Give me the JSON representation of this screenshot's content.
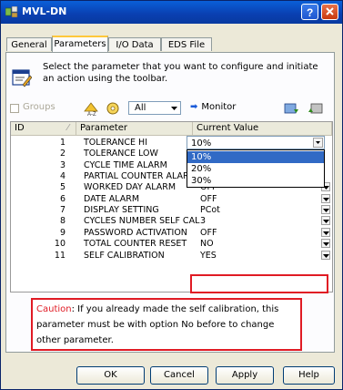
{
  "window": {
    "title": "MVL-DN"
  },
  "tabs": [
    {
      "label": "General"
    },
    {
      "label": "Parameters"
    },
    {
      "label": "I/O Data"
    },
    {
      "label": "EDS File"
    }
  ],
  "header": {
    "text": "Select the parameter that you want to configure and initiate an action using the toolbar."
  },
  "toolbar": {
    "groups_label": "Groups",
    "filter_value": "All",
    "monitor_label": "Monitor"
  },
  "grid": {
    "columns": [
      "ID",
      "Parameter",
      "Current Value"
    ],
    "rows": [
      {
        "id": "1",
        "name": "TOLERANCE HI",
        "value": "10%"
      },
      {
        "id": "2",
        "name": "TOLERANCE LOW",
        "value": ""
      },
      {
        "id": "3",
        "name": "CYCLE TIME ALARM",
        "value": ""
      },
      {
        "id": "4",
        "name": "PARTIAL COUNTER ALARM",
        "value": ""
      },
      {
        "id": "5",
        "name": "WORKED DAY ALARM",
        "value": "OFF"
      },
      {
        "id": "6",
        "name": "DATE ALARM",
        "value": "OFF"
      },
      {
        "id": "7",
        "name": "DISPLAY SETTING",
        "value": "PCot"
      },
      {
        "id": "8",
        "name": "CYCLES NUMBER SELF CAL",
        "value": "3"
      },
      {
        "id": "9",
        "name": "PASSWORD ACTIVATION",
        "value": "OFF"
      },
      {
        "id": "10",
        "name": "TOTAL COUNTER RESET",
        "value": "NO"
      },
      {
        "id": "11",
        "name": "SELF CALIBRATION",
        "value": "YES"
      }
    ],
    "dropdown_options": [
      "10%",
      "20%",
      "30%"
    ]
  },
  "caution": {
    "word": "Caution",
    "text": ": If you already made the self calibration, this parameter must be with option No before to change other parameter."
  },
  "buttons": {
    "ok": "OK",
    "cancel": "Cancel",
    "apply": "Apply",
    "help": "Help"
  },
  "colors": {
    "title_bar": "#0a3fb0",
    "highlight": "#316ac5",
    "annotation_red": "#e01b24"
  }
}
